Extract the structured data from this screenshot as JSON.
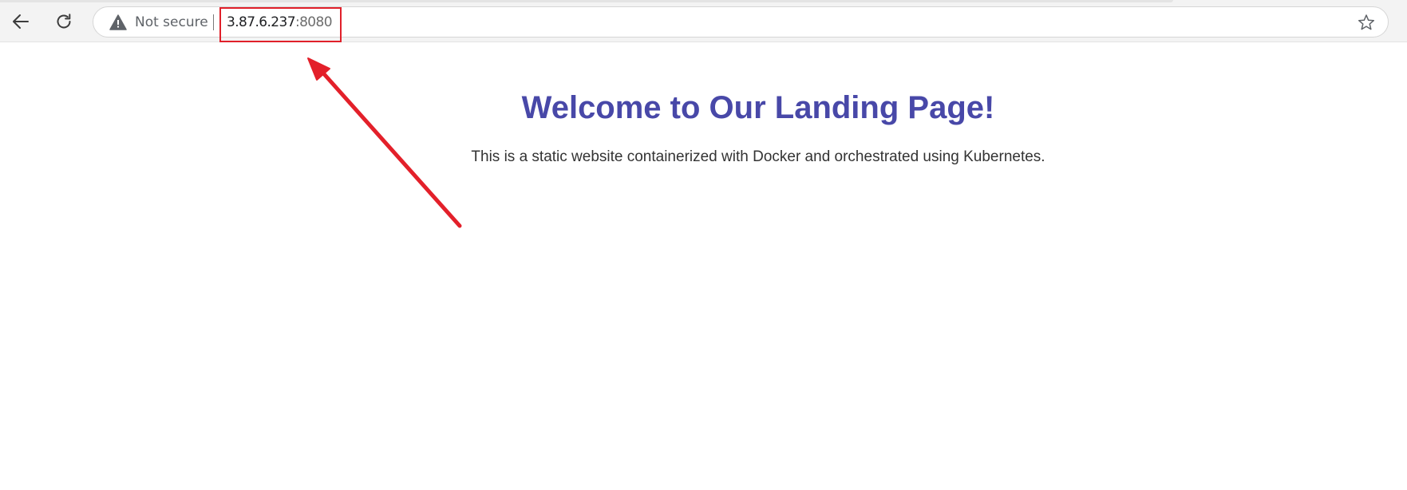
{
  "browser": {
    "security_label": "Not secure",
    "url_host": "3.87.6.237",
    "url_port": ":8080",
    "icons": {
      "back": "arrow-left-icon",
      "reload": "reload-icon",
      "security": "warning-triangle-icon",
      "bookmark": "star-icon"
    }
  },
  "page": {
    "title": "Welcome to Our Landing Page!",
    "subtitle": "This is a static website containerized with Docker and orchestrated using Kubernetes."
  },
  "colors": {
    "title": "#4848a8",
    "annotation": "#e0202a"
  }
}
